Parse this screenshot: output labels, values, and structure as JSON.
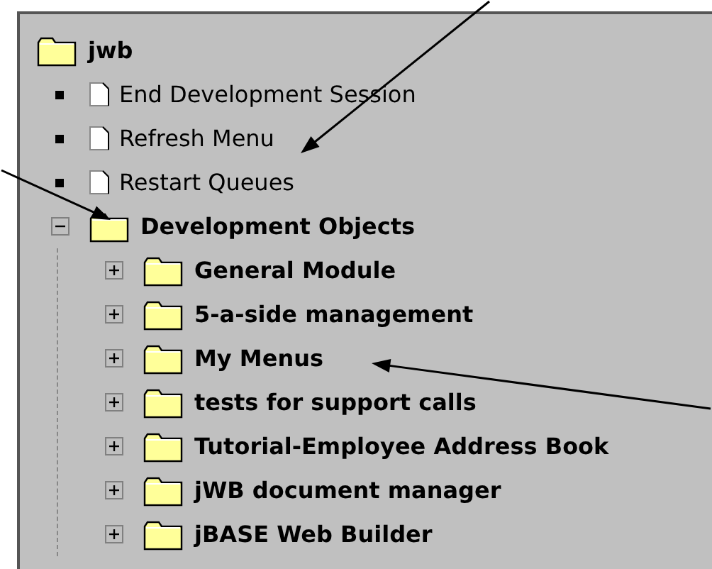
{
  "tree": {
    "label": "jwb",
    "kind": "folder",
    "children": [
      {
        "label": "End Development Session",
        "kind": "leaf"
      },
      {
        "label": "Refresh Menu",
        "kind": "leaf"
      },
      {
        "label": "Restart Queues",
        "kind": "leaf"
      },
      {
        "label": "Development Objects",
        "kind": "folder",
        "expanded": true,
        "children": [
          {
            "label": "General Module",
            "kind": "folder",
            "expanded": false
          },
          {
            "label": "5-a-side management",
            "kind": "folder",
            "expanded": false
          },
          {
            "label": "My Menus",
            "kind": "folder",
            "expanded": false
          },
          {
            "label": "tests for support calls",
            "kind": "folder",
            "expanded": false
          },
          {
            "label": "Tutorial-Employee Address Book",
            "kind": "folder",
            "expanded": false
          },
          {
            "label": "jWB document manager",
            "kind": "folder",
            "expanded": false
          },
          {
            "label": "jBASE Web Builder",
            "kind": "folder",
            "expanded": false
          }
        ]
      }
    ]
  }
}
